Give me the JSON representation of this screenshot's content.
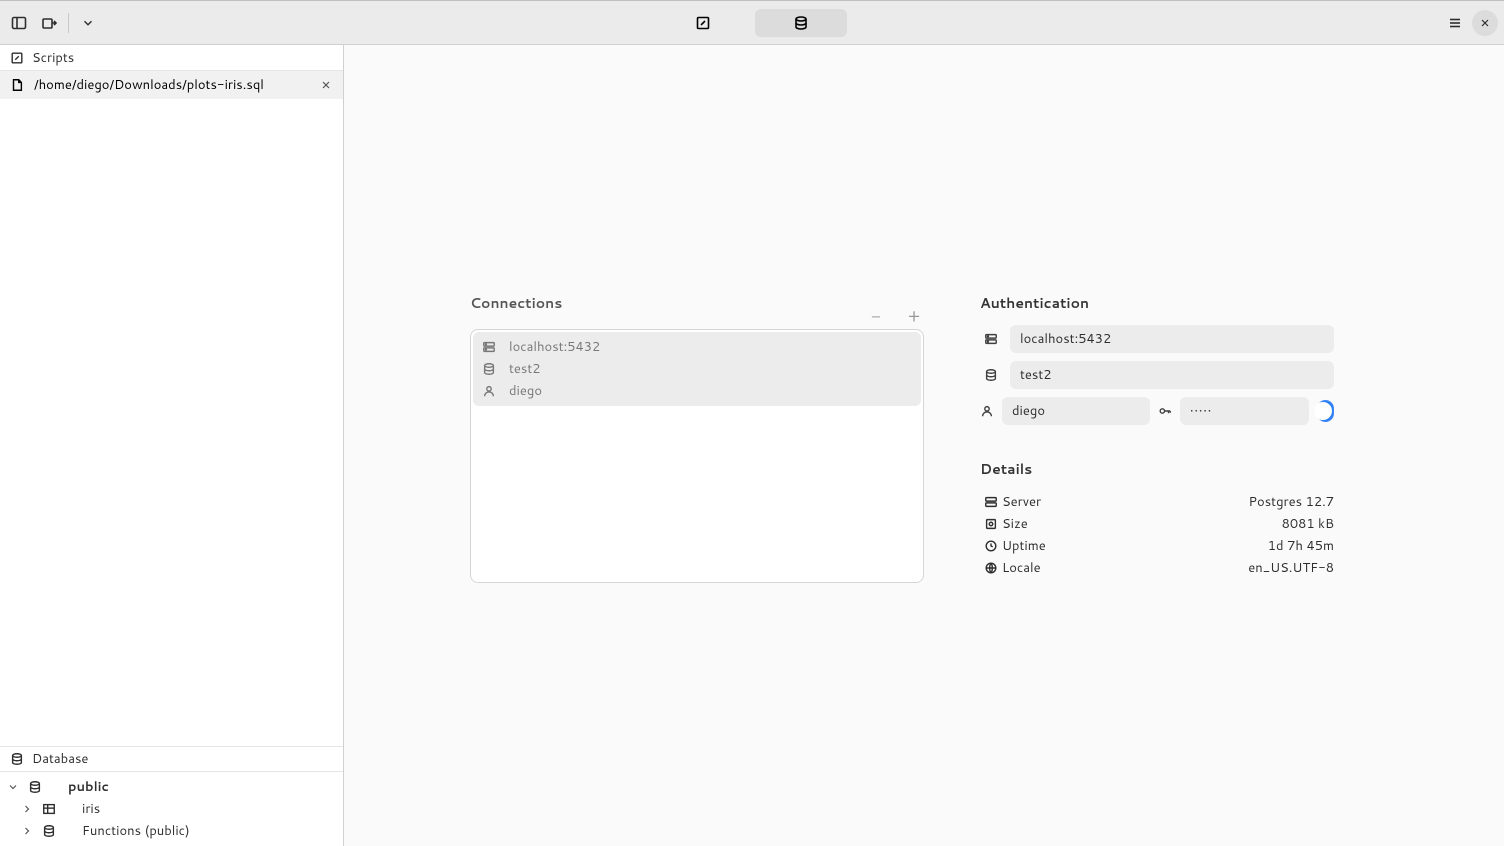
{
  "sidebar": {
    "scripts_label": "Scripts",
    "open_file": "/home/diego/Downloads/plots-iris.sql",
    "database_label": "Database",
    "tree": {
      "schema": "public",
      "table": "iris",
      "functions": "Functions (public)"
    }
  },
  "connections": {
    "title": "Connections",
    "card": {
      "host": "localhost:5432",
      "db": "test2",
      "user": "diego"
    }
  },
  "auth": {
    "title": "Authentication",
    "host": "localhost:5432",
    "db": "test2",
    "user": "diego",
    "password": "•••••"
  },
  "details": {
    "title": "Details",
    "server_label": "Server",
    "server_value": "Postgres 12.7",
    "size_label": "Size",
    "size_value": "8081 kB",
    "uptime_label": "Uptime",
    "uptime_value": "1d 7h 45m",
    "locale_label": "Locale",
    "locale_value": "en_US.UTF-8"
  }
}
